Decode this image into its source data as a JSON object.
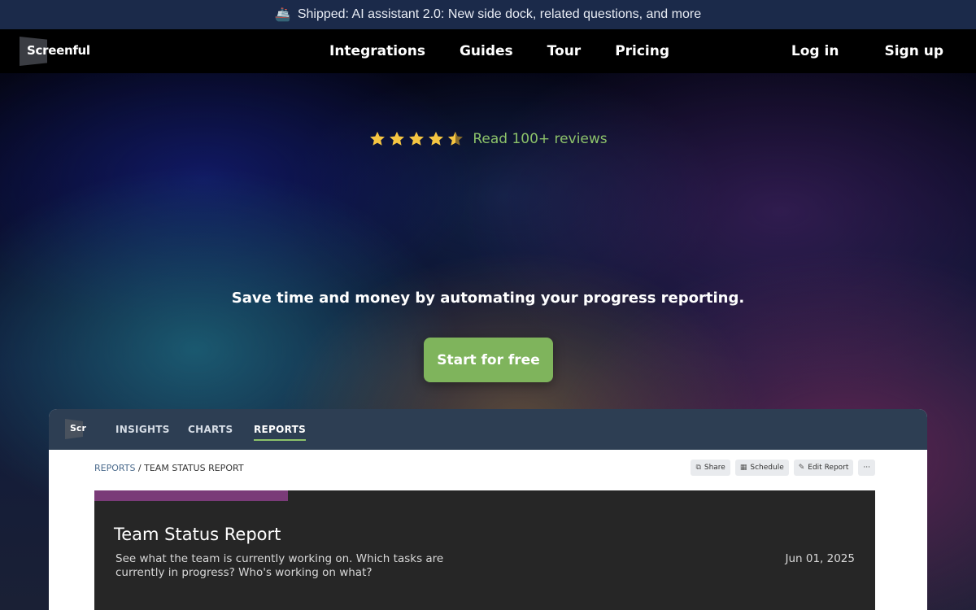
{
  "announcement": {
    "icon": "ship-icon",
    "text": "Shipped: AI assistant 2.0: New side dock, related questions, and more"
  },
  "nav": {
    "logo": "Screenful",
    "links": [
      "Integrations",
      "Guides",
      "Tour",
      "Pricing"
    ],
    "login": "Log in",
    "signup": "Sign up"
  },
  "hero": {
    "rating_stars": 4.5,
    "reviews_link": "Read 100+ reviews",
    "tagline": "Save time and money by automating your progress reporting.",
    "cta": "Start for free"
  },
  "app_preview": {
    "logo": "Scr",
    "tabs": [
      "INSIGHTS",
      "CHARTS",
      "REPORTS"
    ],
    "active_tab": "REPORTS",
    "breadcrumb": {
      "root": "REPORTS",
      "separator": " / ",
      "current": "TEAM STATUS REPORT"
    },
    "actions": [
      "Share",
      "Schedule",
      "Edit Report",
      "···"
    ],
    "report": {
      "title": "Team Status Report",
      "description": "See what the team is currently working on. Which tasks are currently in progress? Who's working on what?",
      "date": "Jun 01, 2025"
    }
  },
  "colors": {
    "accent_green": "#7fb45c",
    "link_green": "#8cc26a",
    "announce_bg": "#1b2a4a",
    "app_bar": "#2d3e53",
    "report_accent": "#7a3b78",
    "star": "#f5c542"
  }
}
